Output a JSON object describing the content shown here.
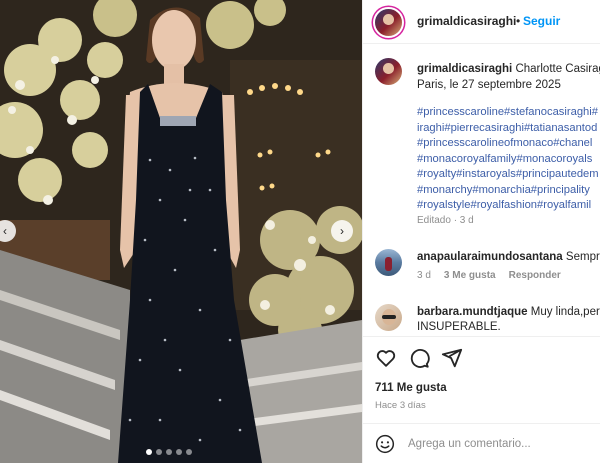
{
  "post": {
    "username": "grimaldicasiraghi",
    "follow_label": "Seguir",
    "separator": "•"
  },
  "caption": {
    "username": "grimaldicasiraghi",
    "text_line1": "Charlotte Casiraghi",
    "text_line2": "Paris, le 27 septembre 2025",
    "hashtag_lines": [
      "#princesscaroline#stefanocasiraghi#",
      "iraghi#pierrecasiraghi#tatianasantod",
      "#princesscarolineofmonaco#chanel",
      "#monacoroyalfamily#monacoroyals",
      "#royalty#instaroyals#principautedem",
      "#monarchy#monarchia#principality",
      "#royalstyle#royalfashion#royalfamil"
    ],
    "edited": "Editado · 3 d"
  },
  "comments": [
    {
      "username": "anapaularaimundosantana",
      "text": "Sempre",
      "age": "3 d",
      "likes": "3 Me gusta",
      "reply": "Responder"
    },
    {
      "username": "barbara.mundtjaque",
      "text": "Muy linda,pero",
      "text_line2": "INSUPERABLE."
    }
  ],
  "stats": {
    "likes": "711 Me gusta",
    "age": "Hace 3 días"
  },
  "composer": {
    "placeholder": "Agrega un comentario..."
  },
  "carousel": {
    "prev_icon": "‹",
    "next_icon": "›"
  },
  "icons": {
    "like": "heart-icon",
    "comment": "comment-icon",
    "share": "share-icon",
    "emoji": "emoji-icon"
  },
  "colors": {
    "link": "#3d5ea8",
    "follow": "#0095f6",
    "muted": "#8e8e8e",
    "text": "#262626"
  }
}
